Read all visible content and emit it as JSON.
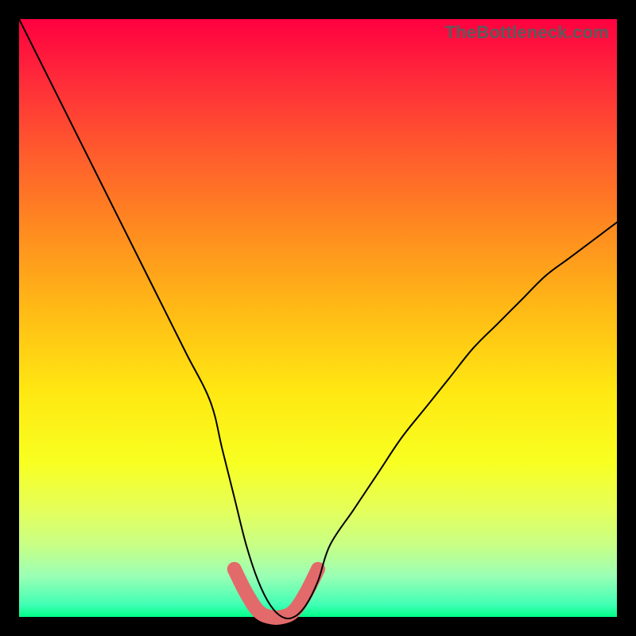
{
  "watermark": {
    "text": "TheBottleneck.com"
  },
  "chart_data": {
    "type": "line",
    "title": "",
    "xlabel": "",
    "ylabel": "",
    "xlim": [
      0,
      100
    ],
    "ylim": [
      0,
      100
    ],
    "legend": false,
    "grid": false,
    "background": "rainbow-vertical-gradient (red top → green bottom)",
    "series": [
      {
        "name": "black-curve",
        "color": "#000000",
        "stroke_width": 2,
        "x": [
          0,
          4,
          8,
          12,
          16,
          20,
          24,
          28,
          32,
          34,
          36,
          38,
          40,
          42,
          44,
          46,
          48,
          50,
          52,
          56,
          60,
          64,
          68,
          72,
          76,
          80,
          84,
          88,
          92,
          96,
          100
        ],
        "values": [
          100,
          92,
          84,
          76,
          68,
          60,
          52,
          44,
          36,
          28,
          20,
          12,
          6,
          2,
          0,
          0,
          2,
          6,
          12,
          18,
          24,
          30,
          35,
          40,
          45,
          49,
          53,
          57,
          60,
          63,
          66
        ]
      },
      {
        "name": "red-highlight",
        "color": "#e36a6a",
        "stroke_width": 12,
        "linecap": "round",
        "x": [
          36,
          38,
          40,
          42,
          44,
          46,
          48,
          50
        ],
        "values": [
          8,
          4,
          1,
          0,
          0,
          1,
          4,
          8
        ]
      }
    ],
    "annotations": [
      {
        "type": "watermark",
        "text": "TheBottleneck.com",
        "position": "top-right"
      }
    ]
  }
}
